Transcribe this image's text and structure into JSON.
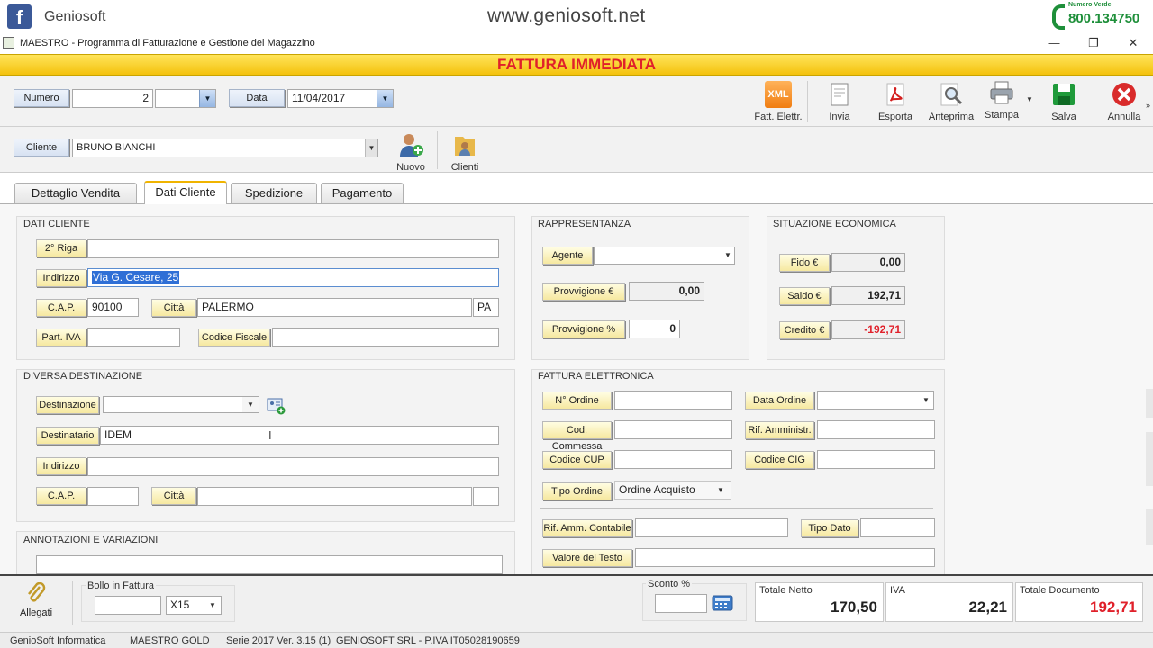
{
  "banner": {
    "brand": "Geniosoft",
    "site": "www.geniosoft.net",
    "phone_label": "Numero Verde",
    "phone": "800.134750"
  },
  "window": {
    "title": "MAESTRO - Programma di Fatturazione e Gestione del Magazzino",
    "minimize": "—",
    "restore": "❐",
    "close": "✕"
  },
  "header": {
    "title": "FATTURA IMMEDIATA"
  },
  "doc": {
    "numero_label": "Numero",
    "numero_value": "2",
    "data_label": "Data",
    "data_value": "11/04/2017"
  },
  "cliente": {
    "label": "Cliente",
    "value": "BRUNO BIANCHI",
    "nuovo": "Nuovo",
    "clienti": "Clienti"
  },
  "toolbar": {
    "xml_badge": "XML",
    "fatt_elettr": "Fatt. Elettr.",
    "invia": "Invia",
    "esporta": "Esporta",
    "anteprima": "Anteprima",
    "stampa": "Stampa",
    "salva": "Salva",
    "annulla": "Annulla"
  },
  "tabs": [
    "Dettaglio Vendita",
    "Dati Cliente",
    "Spedizione",
    "Pagamento"
  ],
  "dati_cliente": {
    "title": "DATI CLIENTE",
    "seconda_riga": "2° Riga",
    "indirizzo_label": "Indirizzo",
    "indirizzo_value": "Via G. Cesare, 25",
    "cap_label": "C.A.P.",
    "cap_value": "90100",
    "citta_label": "Città",
    "citta_value": "PALERMO",
    "prov_value": "PA",
    "piva_label": "Part. IVA",
    "cf_label": "Codice Fiscale"
  },
  "destinazione": {
    "title": "DIVERSA DESTINAZIONE",
    "destinazione_label": "Destinazione",
    "destinatario_label": "Destinatario",
    "destinatario_value": "IDEM",
    "indirizzo_label": "Indirizzo",
    "cap_label": "C.A.P.",
    "citta_label": "Città"
  },
  "annotazioni": {
    "title": "ANNOTAZIONI E VARIAZIONI"
  },
  "rappresentanza": {
    "title": "RAPPRESENTANZA",
    "agente": "Agente",
    "provv_eur": "Provvigione €",
    "provv_eur_value": "0,00",
    "provv_pct": "Provvigione %",
    "provv_pct_value": "0"
  },
  "situazione": {
    "title": "SITUAZIONE ECONOMICA",
    "fido": "Fido €",
    "fido_value": "0,00",
    "saldo": "Saldo €",
    "saldo_value": "192,71",
    "credito": "Credito €",
    "credito_value": "-192,71",
    "negative_color": "#e0202a"
  },
  "fattura_elettronica": {
    "title": "FATTURA ELETTRONICA",
    "n_ordine": "N° Ordine",
    "data_ordine": "Data Ordine",
    "cod_commessa": "Cod. Commessa",
    "rif_amministr": "Rif. Amministr.",
    "codice_cup": "Codice CUP",
    "codice_cig": "Codice CIG",
    "tipo_ordine": "Tipo Ordine",
    "tipo_ordine_value": "Ordine Acquisto",
    "rif_amm_contabile": "Rif. Amm. Contabile",
    "tipo_dato": "Tipo Dato",
    "valore_testo": "Valore del Testo"
  },
  "footer": {
    "allegati": "Allegati",
    "bollo_label": "Bollo in Fattura",
    "bollo_qty": "X15",
    "sconto_label": "Sconto %",
    "totale_netto_label": "Totale Netto",
    "totale_netto": "170,50",
    "iva_label": "IVA",
    "iva": "22,21",
    "totale_doc_label": "Totale Documento",
    "totale_doc": "192,71",
    "totale_doc_color": "#e0202a"
  },
  "status": {
    "company": "GenioSoft Informatica",
    "edition": "MAESTRO GOLD",
    "version": "Serie 2017 Ver. 3.15 (1)",
    "owner": "GENIOSOFT SRL  - P.IVA IT05028190659"
  },
  "icons": {
    "brand": "facebook-icon",
    "window": "app-icon",
    "accent": "#f4c20d"
  }
}
